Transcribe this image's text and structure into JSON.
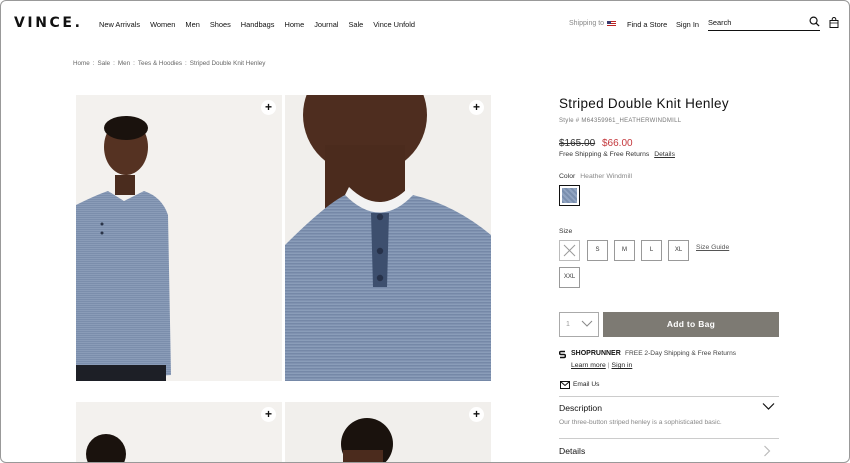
{
  "header": {
    "logo": "VINCE.",
    "nav": [
      "New Arrivals",
      "Women",
      "Men",
      "Shoes",
      "Handbags",
      "Home",
      "Journal",
      "Sale",
      "Vince Unfold"
    ],
    "shipping_to": "Shipping to",
    "find_store": "Find a Store",
    "sign_in": "Sign In",
    "search_placeholder": "Search"
  },
  "breadcrumb": [
    "Home",
    "Sale",
    "Men",
    "Tees & Hoodies",
    "Striped Double Knit Henley"
  ],
  "product": {
    "title": "Striped Double Knit Henley",
    "style": "Style # M64359961_HEATHERWINDMILL",
    "price_original": "$165.00",
    "price_sale": "$66.00",
    "free_shipping": "Free Shipping & Free Returns",
    "details_link": "Details",
    "color_label": "Color",
    "color_value": "Heather Windmill",
    "size_label": "Size",
    "sizes": [
      "",
      "S",
      "M",
      "L",
      "XL",
      "XXL"
    ],
    "size_guide": "Size Guide",
    "quantity": "1",
    "add_to_bag": "Add to Bag"
  },
  "shoprunner": {
    "brand": "SHOPRUNNER",
    "text": "FREE 2-Day Shipping & Free Returns",
    "learn_more": "Learn more",
    "sign_in": "Sign in"
  },
  "email_us": "Email Us",
  "accordion": {
    "description_title": "Description",
    "description_text": "Our three-button striped henley is a sophisticated basic.",
    "details_title": "Details"
  },
  "colors": {
    "sale_price": "#c4373c",
    "add_to_bag_bg": "#7d7a73",
    "shirt_blue": "#7f93b1"
  }
}
